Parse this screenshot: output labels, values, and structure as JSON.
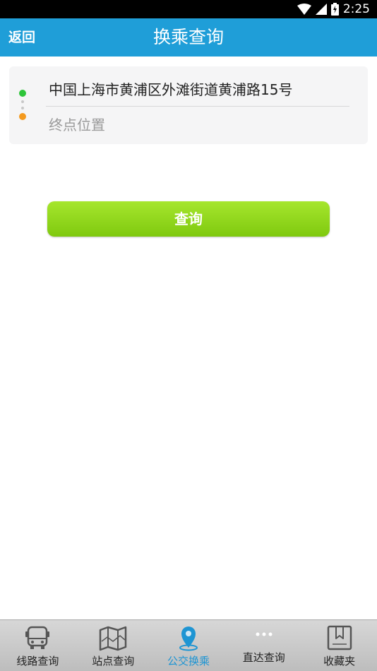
{
  "status_bar": {
    "time": "2:25"
  },
  "header": {
    "back_label": "返回",
    "title": "换乘查询"
  },
  "route": {
    "origin_value": "中国上海市黄浦区外滩街道黄浦路15号",
    "destination_placeholder": "终点位置"
  },
  "query_button_label": "查询",
  "tabs": [
    {
      "label": "线路查询",
      "icon": "bus-icon",
      "active": false
    },
    {
      "label": "站点查询",
      "icon": "map-icon",
      "active": false
    },
    {
      "label": "公交换乘",
      "icon": "location-pin-icon",
      "active": true
    },
    {
      "label": "直达查询",
      "icon": "more-dots-icon",
      "active": false
    },
    {
      "label": "收藏夹",
      "icon": "favorites-icon",
      "active": false
    }
  ],
  "colors": {
    "header": "#1f9ed8",
    "start_dot": "#2ec53a",
    "end_dot": "#f49a1e",
    "button": "#8fd61d",
    "active_tab": "#1e95d3"
  }
}
